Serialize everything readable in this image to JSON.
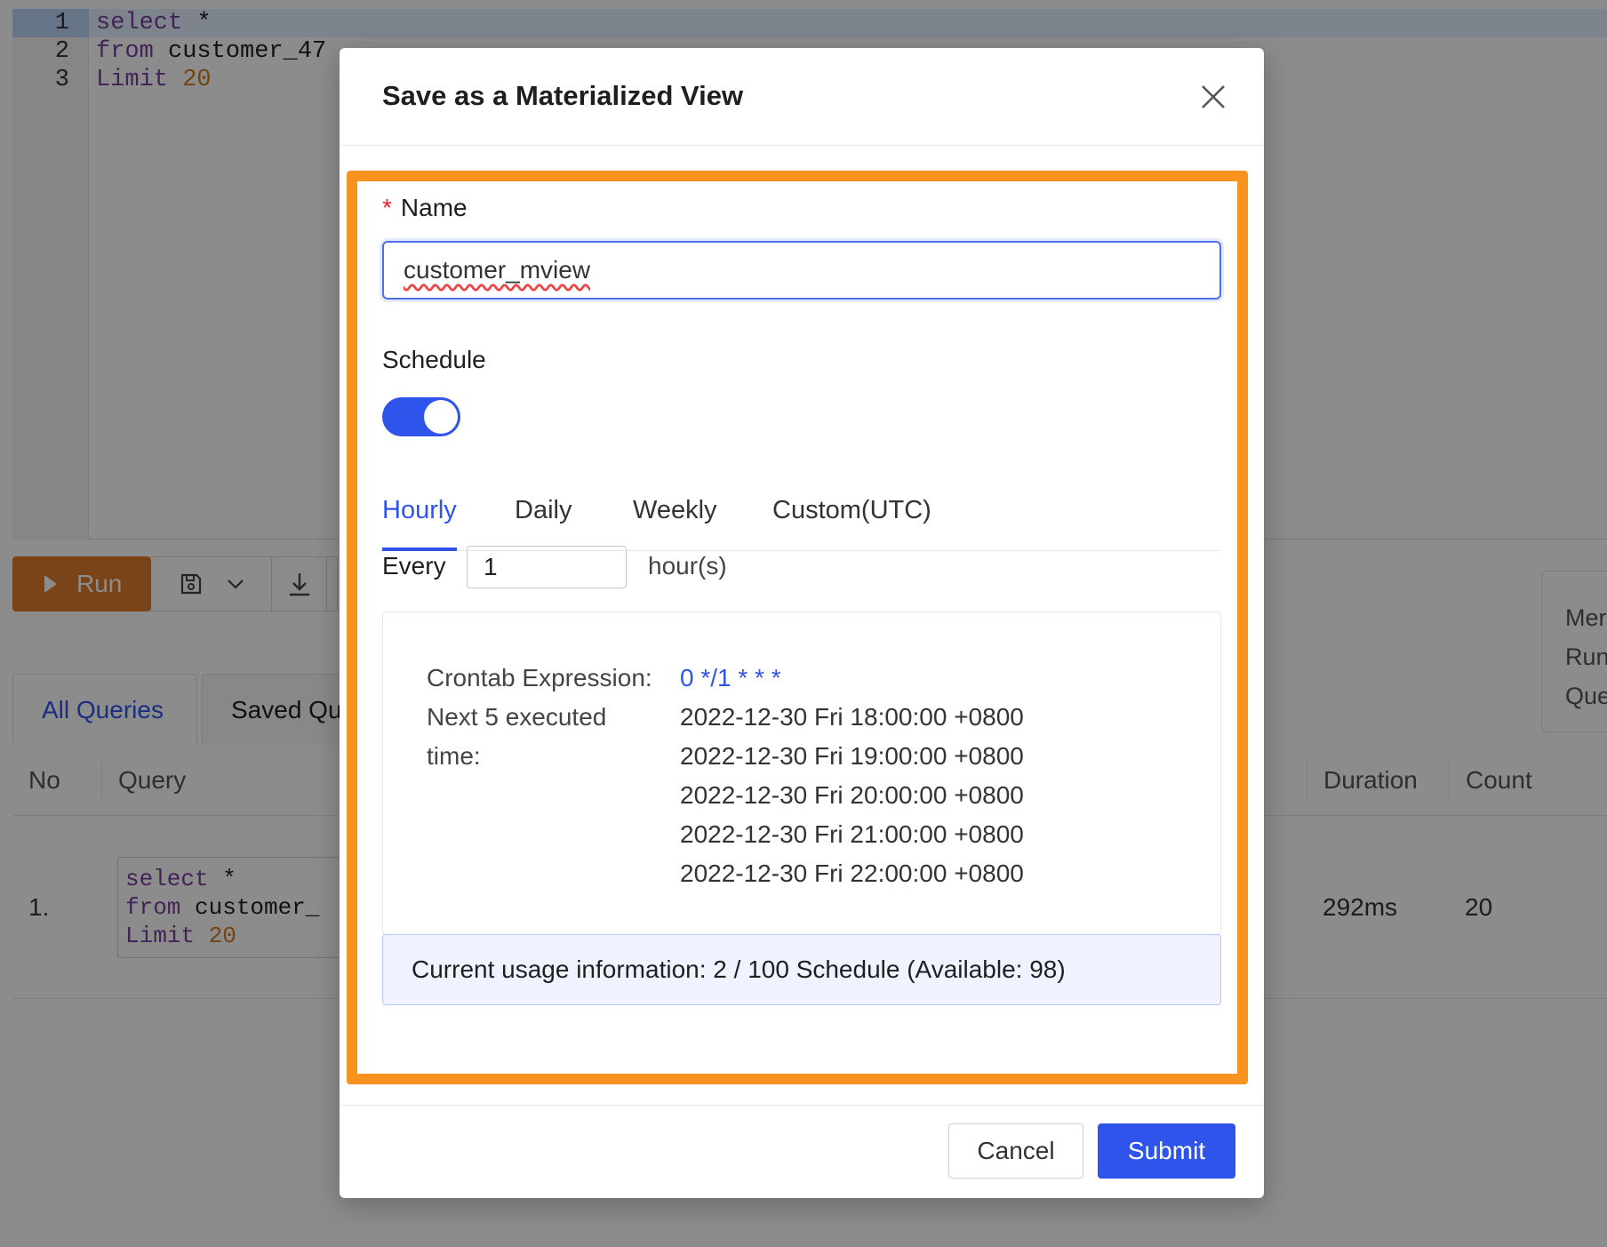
{
  "editor": {
    "lines": [
      {
        "num": "1",
        "kw": "select",
        "rest": " *",
        "tail": ""
      },
      {
        "num": "2",
        "kw": "from",
        "rest": " customer_47",
        "tail": ""
      },
      {
        "num": "3",
        "kw": "Limit",
        "rest": " ",
        "tail": "20"
      }
    ]
  },
  "toolbar": {
    "run_label": "Run",
    "icons": [
      "play-icon",
      "save-icon",
      "chevron-down-icon",
      "download-icon"
    ]
  },
  "side_card": {
    "lines": [
      "Mer",
      "Run",
      "Que"
    ]
  },
  "query_tabs": [
    {
      "label": "All Queries",
      "active": true
    },
    {
      "label": "Saved Qu",
      "active": false
    }
  ],
  "table": {
    "headers": {
      "no": "No",
      "query": "Query",
      "duration": "Duration",
      "count": "Count"
    },
    "rows": [
      {
        "no": "1.",
        "query_lines": [
          "select",
          " *",
          "from",
          " customer_",
          "Limit",
          " ",
          "20"
        ],
        "duration": "292ms",
        "count": "20"
      }
    ]
  },
  "modal": {
    "title": "Save as a Materialized View",
    "close_icon": "close-icon",
    "name_label": "Name",
    "required_mark": "*",
    "name_value": "customer_mview",
    "schedule_label": "Schedule",
    "schedule_enabled": true,
    "schedule_tabs": [
      {
        "label": "Hourly",
        "active": true
      },
      {
        "label": "Daily",
        "active": false
      },
      {
        "label": "Weekly",
        "active": false
      },
      {
        "label": "Custom(UTC)",
        "active": false
      }
    ],
    "every_label": "Every",
    "every_value": "1",
    "every_unit": "hour(s)",
    "crontab_label": "Crontab Expression:",
    "crontab_value": "0 */1 * * *",
    "next_label_line1": "Next 5 executed",
    "next_label_line2": "time:",
    "next_times": [
      "2022-12-30 Fri 18:00:00 +0800",
      "2022-12-30 Fri 19:00:00 +0800",
      "2022-12-30 Fri 20:00:00 +0800",
      "2022-12-30 Fri 21:00:00 +0800",
      "2022-12-30 Fri 22:00:00 +0800"
    ],
    "usage_text": "Current usage information: 2 / 100 Schedule (Available: 98)",
    "cancel_label": "Cancel",
    "submit_label": "Submit"
  },
  "colors": {
    "accent": "#2f54eb",
    "highlight": "#f7931e",
    "run_button": "#e07a2c",
    "required": "#f5222d"
  }
}
